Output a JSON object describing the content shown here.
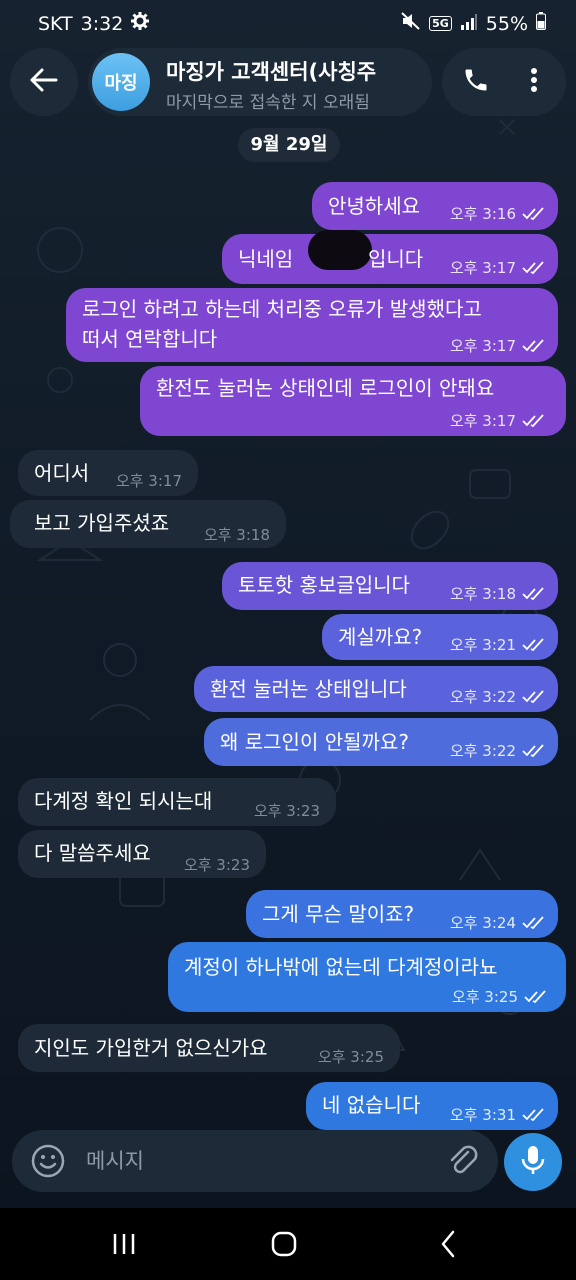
{
  "status_bar": {
    "carrier": "SKT",
    "time": "3:32",
    "network": "5G",
    "battery": "55%"
  },
  "header": {
    "avatar_initials": "마징",
    "title": "마징가 고객센터(사칭주",
    "subtitle": "마지막으로 접속한 지 오래됨"
  },
  "date_chip": "9월 29일",
  "messages": [
    {
      "dir": "out",
      "text": "안녕하세요",
      "time": "오후 3:16"
    },
    {
      "dir": "out",
      "text_before": "닉네임",
      "text_after": "입니다",
      "time": "오후 3:17"
    },
    {
      "dir": "out",
      "lines": [
        "로그인 하려고 하는데 처리중 오류가 발생했다고",
        "떠서 연락합니다"
      ],
      "time": "오후 3:17"
    },
    {
      "dir": "out",
      "text": "환전도 눌러논 상태인데 로그인이 안돼요",
      "time": "오후 3:17"
    },
    {
      "dir": "in",
      "text": "어디서",
      "time": "오후 3:17"
    },
    {
      "dir": "in",
      "text": "보고 가입주셨죠",
      "time": "오후 3:18"
    },
    {
      "dir": "out",
      "text": "토토핫 홍보글입니다",
      "time": "오후 3:18"
    },
    {
      "dir": "out",
      "text": "계실까요?",
      "time": "오후 3:21"
    },
    {
      "dir": "out",
      "text": "환전 눌러논 상태입니다",
      "time": "오후 3:22"
    },
    {
      "dir": "out",
      "text": "왜 로그인이 안될까요?",
      "time": "오후 3:22"
    },
    {
      "dir": "in",
      "text": "다계정 확인 되시는대",
      "time": "오후 3:23"
    },
    {
      "dir": "in",
      "text": "다 말씀주세요",
      "time": "오후 3:23"
    },
    {
      "dir": "out",
      "text": "그게 무슨 말이죠?",
      "time": "오후 3:24"
    },
    {
      "dir": "out",
      "text": "계정이 하나밖에 없는데 다계정이라뇨",
      "time": "오후 3:25"
    },
    {
      "dir": "in",
      "text": "지인도 가입한거 없으신가요",
      "time": "오후 3:25"
    },
    {
      "dir": "out",
      "text": "네 없습니다",
      "time": "오후 3:31"
    }
  ],
  "input": {
    "placeholder": "메시지"
  },
  "colors": {
    "bubble_out_top": "#7f47d1",
    "bubble_out_mid": "#5a63dc",
    "bubble_out_bottom": "#2f78e0",
    "bubble_in": "#1e2a37",
    "accent": "#2f90e0"
  },
  "icons": {
    "back": "arrow-left-icon",
    "call": "phone-icon",
    "more": "more-vertical-icon",
    "emoji": "smiley-icon",
    "attach": "paperclip-icon",
    "mic": "microphone-icon",
    "nav_recents": "recents-icon",
    "nav_home": "home-icon",
    "nav_back": "back-chevron-icon"
  }
}
